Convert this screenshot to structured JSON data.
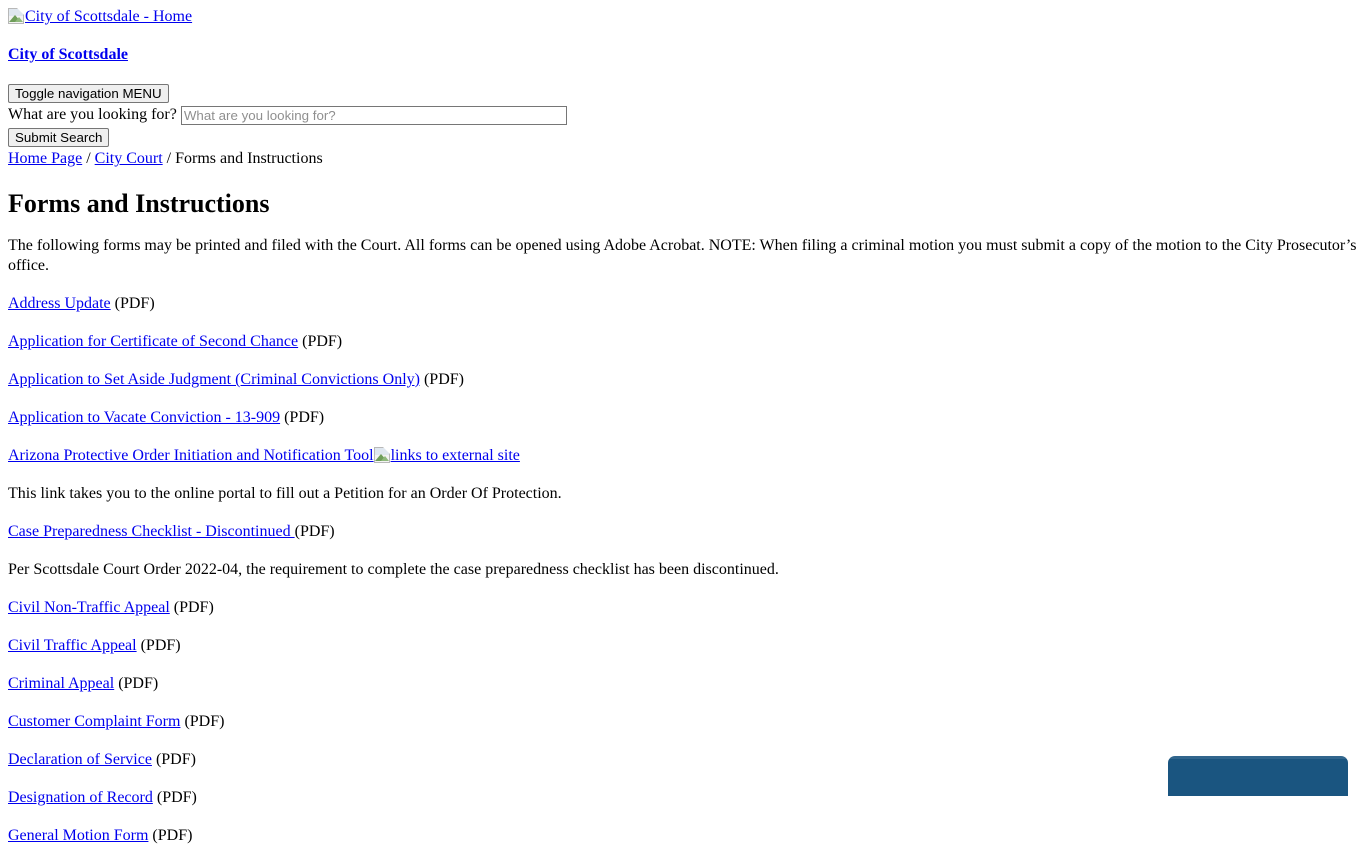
{
  "header": {
    "logo_alt": "City of Scottsdale - Home",
    "logo_icon": "broken-image-icon",
    "site_title": "City of Scottsdale",
    "nav_toggle_label": "Toggle navigation MENU",
    "search_label": "What are you looking for?",
    "search_placeholder": "What are you looking for?",
    "search_value": "",
    "submit_label": "Submit Search"
  },
  "breadcrumb": {
    "items": [
      {
        "label": "Home Page",
        "is_link": true
      },
      {
        "label": "City Court",
        "is_link": true
      },
      {
        "label": "Forms and Instructions",
        "is_link": false
      }
    ],
    "separator": "/"
  },
  "main": {
    "title": "Forms and Instructions",
    "intro": "The following forms may be printed and filed with the Court.  All forms can be opened using Adobe Acrobat.  NOTE: When filing a criminal motion you must submit a copy of the motion to the City Prosecutor’s office.",
    "pdf_suffix": "(PDF)",
    "entries": [
      {
        "link": "Address Update",
        "suffix": " (PDF)"
      },
      {
        "link": "Application for Certificate of Second Chance",
        "suffix": "  (PDF)"
      },
      {
        "link": "Application to Set Aside Judgment (Criminal Convictions Only)",
        "suffix": "  (PDF)"
      },
      {
        "link": "Application to Vacate Conviction - 13-909",
        "suffix": " (PDF)"
      },
      {
        "link": "Arizona Protective Order Initiation and Notification Tool",
        "suffix": "",
        "external_icon_alt": "links to external site",
        "external_icon": "broken-image-icon"
      },
      {
        "note": "This link takes you to the online portal to fill out a Petition for an Order Of Protection."
      },
      {
        "link": "Case Preparedness Checklist - Discontinued ",
        "suffix": "(PDF)"
      },
      {
        "note": "Per Scottsdale Court Order 2022-04, the requirement to complete the case preparedness checklist has been discontinued."
      },
      {
        "link": "Civil Non-Traffic Appeal",
        "suffix": " (PDF)"
      },
      {
        "link": "Civil Traffic Appeal",
        "suffix": " (PDF)"
      },
      {
        "link": "Criminal Appeal",
        "suffix": " (PDF)"
      },
      {
        "link": "Customer Complaint Form",
        "suffix": " (PDF)"
      },
      {
        "link": "Declaration of Service",
        "suffix": " (PDF)"
      },
      {
        "link": "Designation of Record",
        "suffix": " (PDF)"
      },
      {
        "link": "General Motion Form",
        "suffix": " (PDF)"
      }
    ]
  },
  "widget": {
    "name": "chat-widget",
    "color": "#1a5580"
  },
  "colors": {
    "link": "#0000ee",
    "text": "#000000",
    "background": "#ffffff",
    "widget_blue": "#1a5580"
  }
}
